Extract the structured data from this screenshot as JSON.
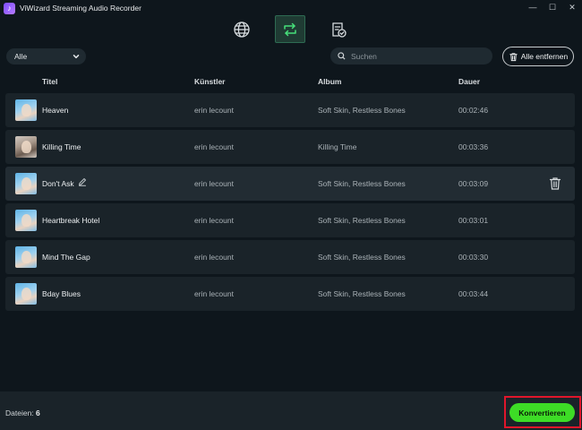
{
  "window": {
    "title": "ViWizard Streaming Audio Recorder",
    "controls": [
      "—",
      "☐",
      "✕"
    ]
  },
  "nav": {
    "tabs": [
      {
        "icon": "globe-icon"
      },
      {
        "icon": "convert-icon",
        "active": true
      },
      {
        "icon": "converted-list-icon"
      }
    ]
  },
  "toolbar": {
    "filter_value": "Alle",
    "search_placeholder": "Suchen",
    "remove_all_label": "Alle entfernen"
  },
  "table": {
    "headers": {
      "title": "Titel",
      "artist": "Künstler",
      "album": "Album",
      "duration": "Dauer"
    },
    "rows": [
      {
        "title": "Heaven",
        "artist": "erin lecount",
        "album": "Soft Skin, Restless Bones",
        "duration": "00:02:46"
      },
      {
        "title": "Killing Time",
        "artist": "erin lecount",
        "album": "Killing Time",
        "duration": "00:03:36"
      },
      {
        "title": "Don't Ask",
        "artist": "erin lecount",
        "album": "Soft Skin, Restless Bones",
        "duration": "00:03:09"
      },
      {
        "title": "Heartbreak Hotel",
        "artist": "erin lecount",
        "album": "Soft Skin, Restless Bones",
        "duration": "00:03:01"
      },
      {
        "title": "Mind The Gap",
        "artist": "erin lecount",
        "album": "Soft Skin, Restless Bones",
        "duration": "00:03:30"
      },
      {
        "title": "Bday Blues",
        "artist": "erin lecount",
        "album": "Soft Skin, Restless Bones",
        "duration": "00:03:44"
      }
    ]
  },
  "footer": {
    "files_label": "Dateien:",
    "files_count": "6",
    "convert_label": "Konvertieren"
  },
  "colors": {
    "background": "#0e161c",
    "row": "#1a2329",
    "accent_green": "#3ddc26",
    "highlight_red": "#e0162b"
  }
}
